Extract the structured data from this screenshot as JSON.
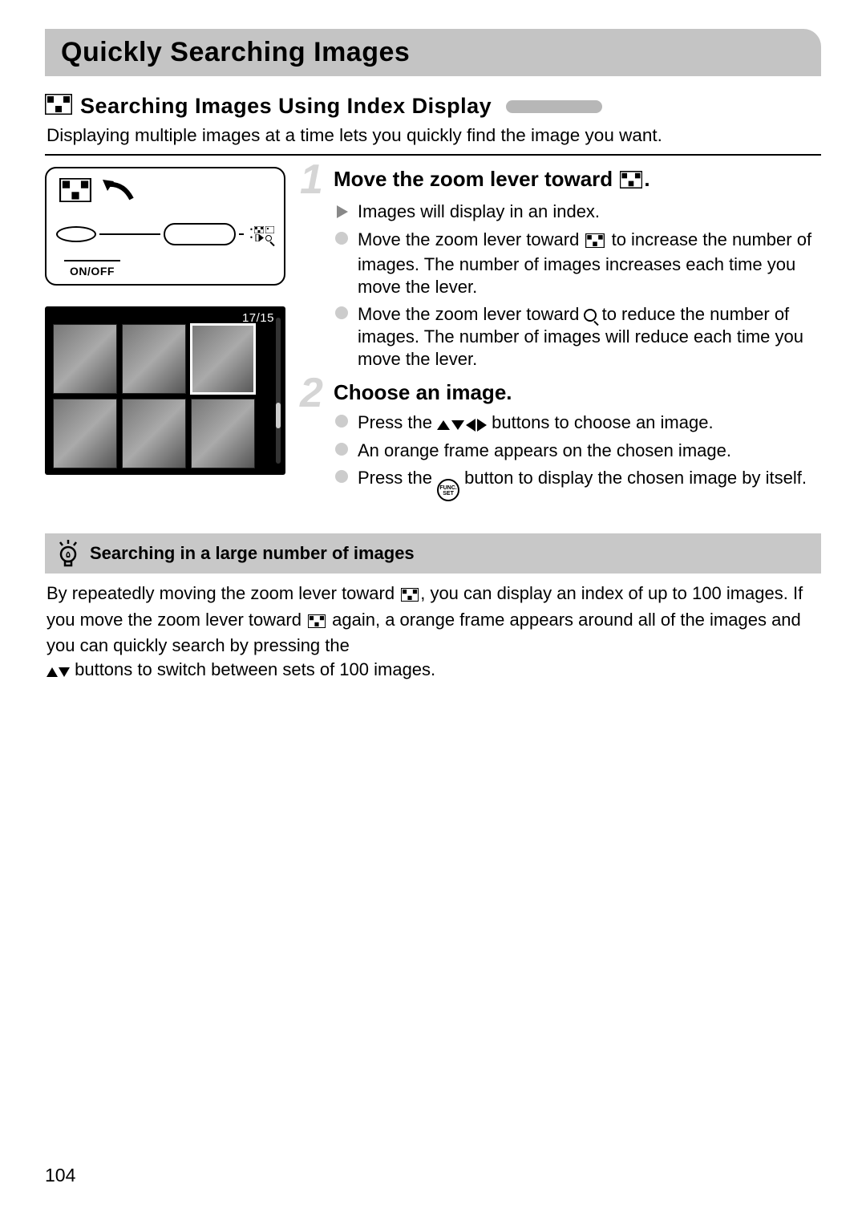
{
  "page_number": "104",
  "title": "Quickly Searching Images",
  "section": {
    "icon": "grid-icon",
    "heading": "Searching Images Using Index Display",
    "intro": "Displaying multiple images at a time lets you quickly find the image you want."
  },
  "illustration": {
    "onoff_label": "ON/OFF",
    "screen_counter": "17/15"
  },
  "steps": [
    {
      "num": "1",
      "title_pre": "Move the zoom lever toward ",
      "title_post": ".",
      "items": [
        {
          "kind": "arrow",
          "text": "Images will display in an index."
        },
        {
          "kind": "dot",
          "pre": "Move the zoom lever toward ",
          "mid_icon": "grid",
          "post": " to increase the number of images. The number of images increases each time you move the lever."
        },
        {
          "kind": "dot",
          "pre": "Move the zoom lever toward ",
          "mid_icon": "magnify",
          "post": " to reduce the number of images. The number of images will reduce each time you move the lever."
        }
      ]
    },
    {
      "num": "2",
      "title_pre": "Choose an image.",
      "title_post": "",
      "items": [
        {
          "kind": "dot",
          "pre": "Press the ",
          "mid_icon": "dpad",
          "post": " buttons to choose an image."
        },
        {
          "kind": "dot",
          "text": "An orange frame appears on the chosen image."
        },
        {
          "kind": "dot",
          "pre": "Press the ",
          "mid_icon": "func",
          "post": " button to display the chosen image by itself."
        }
      ]
    }
  ],
  "tip": {
    "heading": "Searching in a large number of images",
    "body_parts": {
      "a": "By repeatedly moving the zoom lever toward ",
      "b": ", you can display an index of up to 100 images. If you move the zoom lever toward ",
      "c": " again, a orange frame appears around all of the images and you can quickly search by pressing the ",
      "d": " buttons to switch between sets of 100 images."
    }
  },
  "icons": {
    "func_top": "FUNC.",
    "func_bot": "SET"
  }
}
